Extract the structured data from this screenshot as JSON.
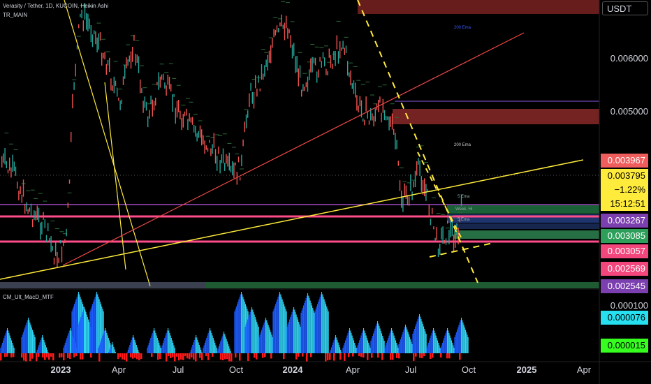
{
  "header": {
    "symbol": "Verasity / Tether, 1D, KUCOIN, Heikin Ashi",
    "indicator": "TR_MAIN",
    "macd_indicator": "CM_Ult_MacD_MTF"
  },
  "price_axis": {
    "currency": "USDT",
    "ticks": [
      "0.006000",
      "0.005000"
    ]
  },
  "price_badges": [
    {
      "label": "0.003967",
      "bg": "#f05d5d",
      "fg": "#ffffff"
    },
    {
      "label": "0.003795",
      "bg": "#ffeb3b",
      "fg": "#000000"
    },
    {
      "label": "−1.22%",
      "bg": "#ffeb3b",
      "fg": "#000000"
    },
    {
      "label": "15:12:51",
      "bg": "#ffeb3b",
      "fg": "#000000"
    },
    {
      "label": "0.003267",
      "bg": "#7b3fb0",
      "fg": "#ffffff"
    },
    {
      "label": "0.003085",
      "bg": "#2e9e5b",
      "fg": "#ffffff"
    },
    {
      "label": "0.003057",
      "bg": "#f2467c",
      "fg": "#ffffff"
    },
    {
      "label": "0.002569",
      "bg": "#f2467c",
      "fg": "#ffffff"
    },
    {
      "label": "0.002545",
      "bg": "#7b3fb0",
      "fg": "#ffffff"
    }
  ],
  "macd_axis": {
    "tick": "0.000100",
    "badges": [
      {
        "label": "0.000076",
        "bg": "#26e0f0",
        "fg": "#000000"
      },
      {
        "label": "0.000015",
        "bg": "#36ff20",
        "fg": "#000000"
      }
    ]
  },
  "time_axis": {
    "ticks": [
      {
        "label": "2023",
        "bold": true
      },
      {
        "label": "Apr",
        "bold": false
      },
      {
        "label": "Jul",
        "bold": false
      },
      {
        "label": "Oct",
        "bold": false
      },
      {
        "label": "2024",
        "bold": true
      },
      {
        "label": "Apr",
        "bold": false
      },
      {
        "label": "Jul",
        "bold": false
      },
      {
        "label": "Oct",
        "bold": false
      },
      {
        "label": "2025",
        "bold": true
      },
      {
        "label": "Apr",
        "bold": false
      }
    ]
  },
  "chart_annotations": {
    "ema_200_top": "200 Ema",
    "ema_200": "200 Ema",
    "ema_5": "5 Ema",
    "ema_5b": "5 Ema",
    "weekly_high": "Week. Hi"
  },
  "colors": {
    "background": "#000000",
    "bull_candle": "#26a69a",
    "bear_candle": "#ef5350",
    "trendline_yellow": "#ffeb3b",
    "trendline_red": "#f04848",
    "level_pink": "#ff4d8a",
    "level_magenta": "#d048ff",
    "supply_zone": "#7a2020",
    "macd_blue": "#1d5cff",
    "macd_cyan": "#2ed5f5",
    "macd_red": "#ff1a1a"
  }
}
